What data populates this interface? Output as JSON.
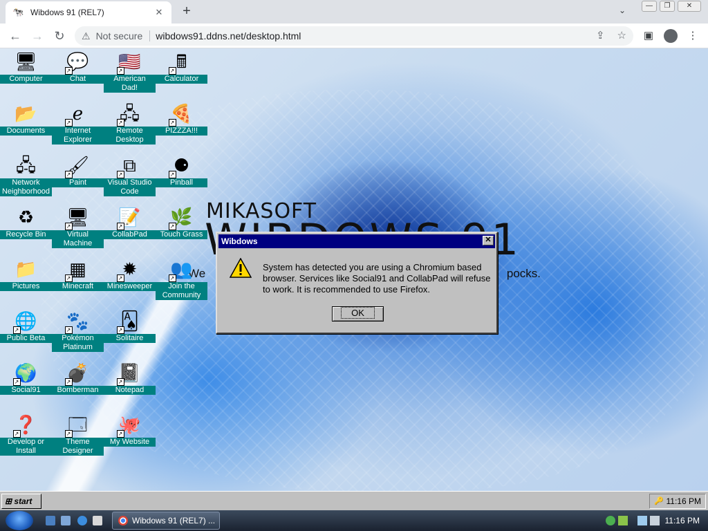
{
  "browser": {
    "tab_title": "Wibdows 91 (REL7)",
    "security_label": "Not secure",
    "url": "wibdows91.ddns.net/desktop.html"
  },
  "desktop": {
    "brand_top": "MIKASOFT",
    "brand_main": "WIBDOWS 91",
    "slogan_start": "We",
    "slogan_end": "pocks.",
    "icons": [
      {
        "label": "Computer",
        "glyph": "🖥"
      },
      {
        "label": "Chat",
        "glyph": "💬"
      },
      {
        "label": "American Dad!",
        "glyph": "🇺🇸"
      },
      {
        "label": "Calculator",
        "glyph": "🖩"
      },
      {
        "label": "Documents",
        "glyph": "📂"
      },
      {
        "label": "Internet Explorer",
        "glyph": "ℯ"
      },
      {
        "label": "Remote Desktop",
        "glyph": "🖧"
      },
      {
        "label": "PIZZZA!!!",
        "glyph": "🍕"
      },
      {
        "label": "Network Neighborhood",
        "glyph": "🖧"
      },
      {
        "label": "Paint",
        "glyph": "🖌"
      },
      {
        "label": "Visual Studio Code",
        "glyph": "⧉"
      },
      {
        "label": "Pinball",
        "glyph": "⚈"
      },
      {
        "label": "Recycle Bin",
        "glyph": "♻"
      },
      {
        "label": "Virtual Machine",
        "glyph": "🖥"
      },
      {
        "label": "CollabPad",
        "glyph": "📝"
      },
      {
        "label": "Touch Grass",
        "glyph": "🌿"
      },
      {
        "label": "Pictures",
        "glyph": "📁"
      },
      {
        "label": "Minecraft",
        "glyph": "▦"
      },
      {
        "label": "Minesweeper",
        "glyph": "✹"
      },
      {
        "label": "Join the Community",
        "glyph": "👥"
      },
      {
        "label": "Public Beta",
        "glyph": "🌐"
      },
      {
        "label": "Pokémon Platinum",
        "glyph": "🐾"
      },
      {
        "label": "Solitaire",
        "glyph": "🂡"
      },
      {
        "label": "Social91",
        "glyph": "🌍"
      },
      {
        "label": "Bomberman",
        "glyph": "💣"
      },
      {
        "label": "Notepad",
        "glyph": "📓"
      },
      {
        "label": "Develop or Install",
        "glyph": "❓"
      },
      {
        "label": "Theme Designer",
        "glyph": "🗔"
      },
      {
        "label": "My Website",
        "glyph": "🐙"
      }
    ]
  },
  "dialog": {
    "title": "Wibdows",
    "close": "✕",
    "message": "System has detected you are using a Chromium based browser. Services like Social91 and CollabPad will refuse to work. It is recommended to use Firefox.",
    "ok_label": "OK"
  },
  "taskbar91": {
    "start_label": "start",
    "clock": "11:16 PM"
  },
  "os_taskbar": {
    "app_label": "Wibdows 91 (REL7) ...",
    "clock": "11:16 PM"
  },
  "colors": {
    "icon_label_bg": "#008080",
    "dialog_title_bg": "#000080",
    "win9x_gray": "#c0c0c0"
  }
}
